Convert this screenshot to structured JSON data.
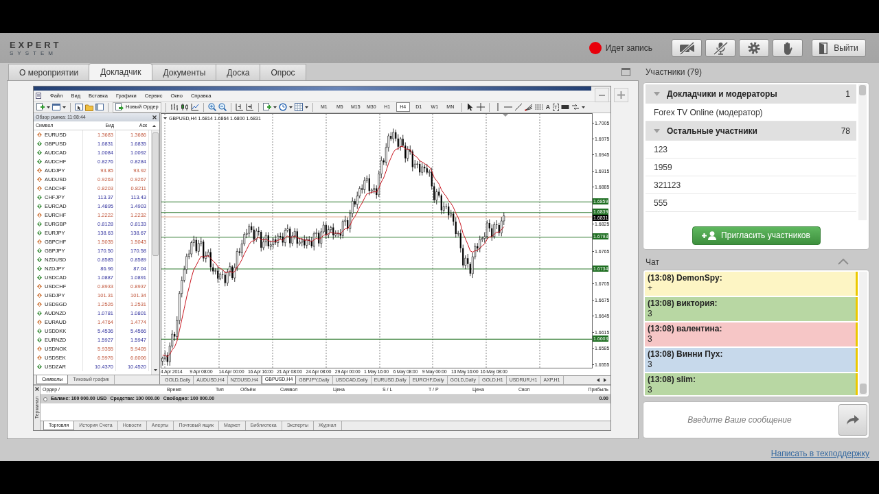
{
  "header": {
    "logo": {
      "title": "EXPERT",
      "subtitle": "SYSTEM"
    },
    "recording": {
      "label": "Идет запись",
      "on": true
    },
    "camera": {
      "on": false
    },
    "microphone": {
      "on": false
    },
    "exit_button": "Выйти"
  },
  "tabs": [
    {
      "label": "О мероприятии",
      "selected": false
    },
    {
      "label": "Докладчик",
      "selected": true
    },
    {
      "label": "Документы",
      "selected": false
    },
    {
      "label": "Доска",
      "selected": false
    },
    {
      "label": "Опрос",
      "selected": false
    }
  ],
  "app_window": {
    "menu": [
      "Файл",
      "Вид",
      "Вставка",
      "Графики",
      "Сервис",
      "Окно",
      "Справка"
    ],
    "toolbar": {
      "new_order_button": "Новый Ордер",
      "timeframes": [
        {
          "label": "M1",
          "selected": false
        },
        {
          "label": "M5",
          "selected": false
        },
        {
          "label": "M15",
          "selected": false
        },
        {
          "label": "M30",
          "selected": false
        },
        {
          "label": "H1",
          "selected": false
        },
        {
          "label": "H4",
          "selected": true
        },
        {
          "label": "D1",
          "selected": false
        },
        {
          "label": "W1",
          "selected": false
        },
        {
          "label": "MN",
          "selected": false
        }
      ],
      "text_tools": [
        "A",
        "T"
      ]
    },
    "market_watch": {
      "title": "Обзор рынка: 11:08:44",
      "columns": [
        "Символ",
        "Бид",
        "Аск"
      ],
      "rows": [
        {
          "symbol": "EURUSD",
          "bid": "1.3683",
          "ask": "1.3686",
          "rising": false
        },
        {
          "symbol": "GBPUSD",
          "bid": "1.6831",
          "ask": "1.6835",
          "rising": true
        },
        {
          "symbol": "AUDCAD",
          "bid": "1.0084",
          "ask": "1.0092",
          "rising": true
        },
        {
          "symbol": "AUDCHF",
          "bid": "0.8276",
          "ask": "0.8284",
          "rising": true
        },
        {
          "symbol": "AUDJPY",
          "bid": "93.85",
          "ask": "93.92",
          "rising": false
        },
        {
          "symbol": "AUDUSD",
          "bid": "0.9263",
          "ask": "0.9267",
          "rising": false
        },
        {
          "symbol": "CADCHF",
          "bid": "0.8203",
          "ask": "0.8211",
          "rising": false
        },
        {
          "symbol": "CHFJPY",
          "bid": "113.37",
          "ask": "113.43",
          "rising": true
        },
        {
          "symbol": "EURCAD",
          "bid": "1.4895",
          "ask": "1.4903",
          "rising": true
        },
        {
          "symbol": "EURCHF",
          "bid": "1.2222",
          "ask": "1.2232",
          "rising": false
        },
        {
          "symbol": "EURGBP",
          "bid": "0.8128",
          "ask": "0.8133",
          "rising": true
        },
        {
          "symbol": "EURJPY",
          "bid": "138.63",
          "ask": "138.67",
          "rising": true
        },
        {
          "symbol": "GBPCHF",
          "bid": "1.5035",
          "ask": "1.5043",
          "rising": false
        },
        {
          "symbol": "GBPJPY",
          "bid": "170.50",
          "ask": "170.58",
          "rising": true
        },
        {
          "symbol": "NZDUSD",
          "bid": "0.8585",
          "ask": "0.8589",
          "rising": true
        },
        {
          "symbol": "NZDJPY",
          "bid": "86.96",
          "ask": "87.04",
          "rising": true
        },
        {
          "symbol": "USDCAD",
          "bid": "1.0887",
          "ask": "1.0891",
          "rising": true
        },
        {
          "symbol": "USDCHF",
          "bid": "0.8933",
          "ask": "0.8937",
          "rising": false
        },
        {
          "symbol": "USDJPY",
          "bid": "101.31",
          "ask": "101.34",
          "rising": false
        },
        {
          "symbol": "USDSGD",
          "bid": "1.2526",
          "ask": "1.2531",
          "rising": false
        },
        {
          "symbol": "AUDNZD",
          "bid": "1.0781",
          "ask": "1.0801",
          "rising": true
        },
        {
          "symbol": "EURAUD",
          "bid": "1.4764",
          "ask": "1.4774",
          "rising": false
        },
        {
          "symbol": "USDDKK",
          "bid": "5.4536",
          "ask": "5.4566",
          "rising": true
        },
        {
          "symbol": "EURNZD",
          "bid": "1.5927",
          "ask": "1.5947",
          "rising": true
        },
        {
          "symbol": "USDNOK",
          "bid": "5.9355",
          "ask": "5.9405",
          "rising": false
        },
        {
          "symbol": "USDSEK",
          "bid": "6.5976",
          "ask": "6.6006",
          "rising": false
        },
        {
          "symbol": "USDZAR",
          "bid": "10.4370",
          "ask": "10.4520",
          "rising": true
        }
      ],
      "tabs": [
        {
          "label": "Символы",
          "selected": true
        },
        {
          "label": "Тиковый график",
          "selected": false
        }
      ]
    },
    "chart": {
      "header": "GBPUSD,H4 1.6814 1.6864 1.6800 1.6831",
      "price_ticks": [
        "1.7005",
        "1.6975",
        "1.6945",
        "1.6915",
        "1.6885",
        "1.6825",
        "1.6765",
        "1.6705",
        "1.6675",
        "1.6645",
        "1.6615",
        "1.6585",
        "1.6555"
      ],
      "levels": [
        {
          "label": "1.6859",
          "kind": "level"
        },
        {
          "label": "1.6839",
          "kind": "level"
        },
        {
          "label": "1.6831",
          "kind": "current"
        },
        {
          "label": "1.6793",
          "kind": "level"
        },
        {
          "label": "1.6734",
          "kind": "level"
        },
        {
          "label": "1.6603",
          "kind": "level"
        }
      ],
      "time_labels": [
        "4 Apr 2014",
        "9 Apr 08:00",
        "14 Apr 00:00",
        "16 Apr 16:00",
        "21 Apr 08:00",
        "24 Apr 08:00",
        "29 Apr 00:00",
        "1 May 16:00",
        "6 May 08:00",
        "9 May 00:00",
        "13 May 16:00",
        "16 May 08:00"
      ]
    },
    "chart_tabs": [
      {
        "label": "GOLD,Daily",
        "selected": false
      },
      {
        "label": "AUDUSD,H4",
        "selected": false
      },
      {
        "label": "NZDUSD,H4",
        "selected": false
      },
      {
        "label": "GBPUSD,H4",
        "selected": true
      },
      {
        "label": "GBPJPY,Daily",
        "selected": false
      },
      {
        "label": "USDCAD,Daily",
        "selected": false
      },
      {
        "label": "EURUSD,Daily",
        "selected": false
      },
      {
        "label": "EURCHF,Daily",
        "selected": false
      },
      {
        "label": "GOLD,Daily",
        "selected": false
      },
      {
        "label": "GOLD,H1",
        "selected": false
      },
      {
        "label": "USDRUR,H1",
        "selected": false
      },
      {
        "label": "AXP,H1",
        "selected": false
      }
    ],
    "terminal": {
      "title": "Терминал",
      "columns": [
        "Ордер /",
        "Время",
        "Тип",
        "Объём",
        "Символ",
        "Цена",
        "S / L",
        "T / P",
        "Цена",
        "Своп",
        "Прибыль"
      ],
      "summary": [
        "Баланс: 100 000.00 USD",
        "Средства: 100 000.00",
        "Свободно: 100 000.00"
      ],
      "profit": "0.00",
      "tabs": [
        {
          "label": "Торговля",
          "selected": true
        },
        {
          "label": "История Счета",
          "selected": false
        },
        {
          "label": "Новости",
          "selected": false
        },
        {
          "label": "Алерты",
          "selected": false
        },
        {
          "label": "Почтовый ящик",
          "selected": false
        },
        {
          "label": "Маркет",
          "selected": false
        },
        {
          "label": "Библиотека",
          "selected": false
        },
        {
          "label": "Эксперты",
          "selected": false
        },
        {
          "label": "Журнал",
          "selected": false
        }
      ]
    }
  },
  "participants": {
    "title": "Участники (79)",
    "groups": [
      {
        "name": "Докладчики и модераторы",
        "count": "1",
        "expanded": true,
        "children": [
          {
            "name": "Forex TV Online (модератор)"
          }
        ]
      },
      {
        "name": "Остальные участники",
        "count": "78",
        "expanded": true,
        "children": [
          {
            "name": "123"
          },
          {
            "name": "1959"
          },
          {
            "name": "321123"
          },
          {
            "name": "555"
          }
        ]
      }
    ],
    "invite_button": "Пригласить участников"
  },
  "chat": {
    "title": "Чат",
    "messages": [
      {
        "author": "(13:08) DemonSpy:",
        "text": "+",
        "color": "#fdf5c4"
      },
      {
        "author": "(13:08) виктория:",
        "text": "3",
        "color": "#b8d7a3"
      },
      {
        "author": "(13:08) валентина:",
        "text": "3",
        "color": "#f6c6c6"
      },
      {
        "author": "(13:08) Винни Пух:",
        "text": "3",
        "color": "#c7d9eb"
      },
      {
        "author": "(13:08) slim:",
        "text": "3",
        "color": "#b8d7a3"
      }
    ],
    "input": {
      "placeholder": "Введите Ваше сообщение"
    }
  },
  "support_link": "Написать в техподдержку"
}
